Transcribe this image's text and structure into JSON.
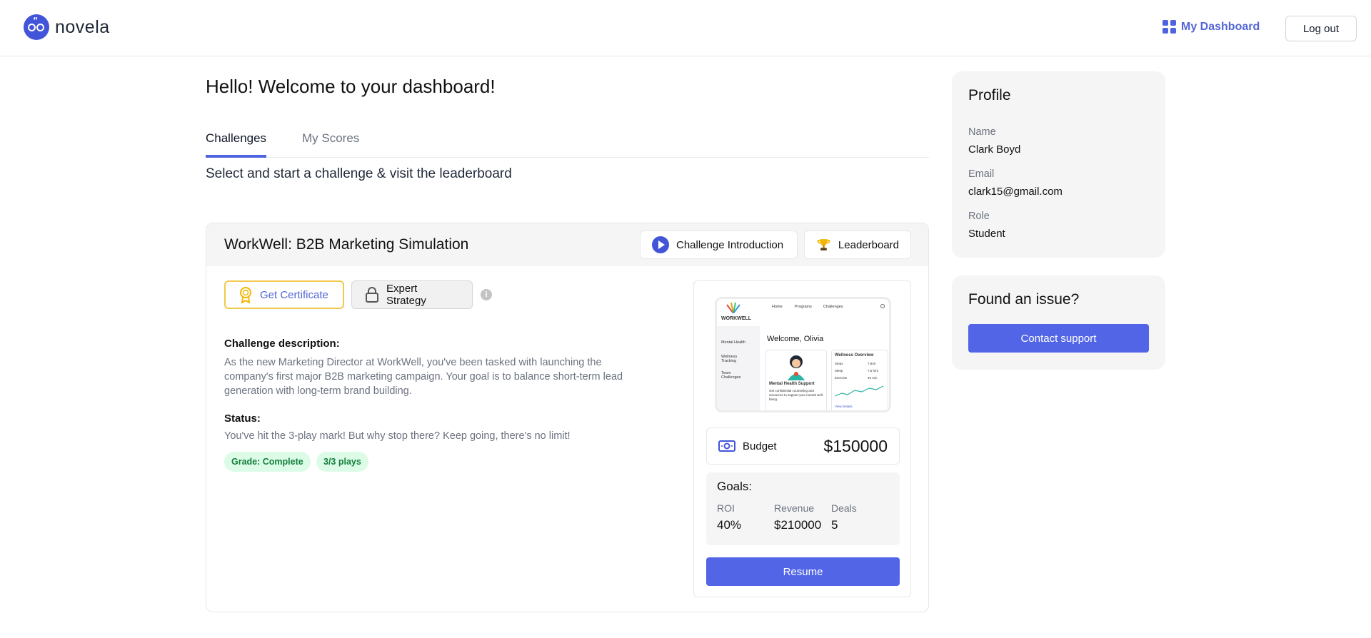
{
  "header": {
    "brand": "novela",
    "dashboard_link": "My Dashboard",
    "logout_label": "Log out"
  },
  "main": {
    "greeting": "Hello! Welcome to your dashboard!",
    "tabs": [
      {
        "label": "Challenges",
        "active": true
      },
      {
        "label": "My Scores",
        "active": false
      }
    ],
    "subtitle": "Select and start a challenge & visit the leaderboard"
  },
  "challenge": {
    "title": "WorkWell: B2B Marketing Simulation",
    "intro_button": "Challenge Introduction",
    "leaderboard_button": "Leaderboard",
    "certificate_button": "Get Certificate",
    "expert_button": "Expert Strategy",
    "info_glyph": "i",
    "description_label": "Challenge description:",
    "description": "As the new Marketing Director at WorkWell, you've been tasked with launching the company's first major B2B marketing campaign. Your goal is to balance short-term lead generation with long-term brand building.",
    "status_label": "Status:",
    "status_text": "You've hit the 3-play mark! But why stop there? Keep going, there's no limit!",
    "badges": [
      "Grade: Complete",
      "3/3 plays"
    ],
    "preview": {
      "brand": "WORKWELL",
      "nav": [
        "Home",
        "Programs",
        "Challenges"
      ],
      "sidebar": [
        "Mental Health",
        "Wellness Tracking",
        "Team Challenges"
      ],
      "welcome": "Welcome, Olivia",
      "card_title": "Mental Health Support",
      "card_text": "Get confidential counseling and resources to support your mental well-being.",
      "overview_title": "Wellness Overview",
      "overview_rows": [
        {
          "k": "Steps",
          "v": "7,840"
        },
        {
          "k": "Sleep",
          "v": "7.5 h/nt"
        },
        {
          "k": "Exercise",
          "v": "45 min"
        }
      ],
      "view_details": "View Details"
    },
    "budget_label": "Budget",
    "budget_value": "$150000",
    "goals_title": "Goals:",
    "goals": [
      {
        "label": "ROI",
        "value": "40%"
      },
      {
        "label": "Revenue",
        "value": "$210000"
      },
      {
        "label": "Deals",
        "value": "5"
      }
    ],
    "resume_button": "Resume"
  },
  "profile": {
    "title": "Profile",
    "fields": [
      {
        "label": "Name",
        "value": "Clark Boyd"
      },
      {
        "label": "Email",
        "value": "clark15@gmail.com"
      },
      {
        "label": "Role",
        "value": "Student"
      }
    ]
  },
  "issue": {
    "title": "Found an issue?",
    "button": "Contact support"
  },
  "colors": {
    "accent": "#5265e6",
    "brand": "#4254d8",
    "badge_bg": "#dcfce7",
    "badge_text": "#15803d",
    "certificate_border": "#f2c94c"
  }
}
